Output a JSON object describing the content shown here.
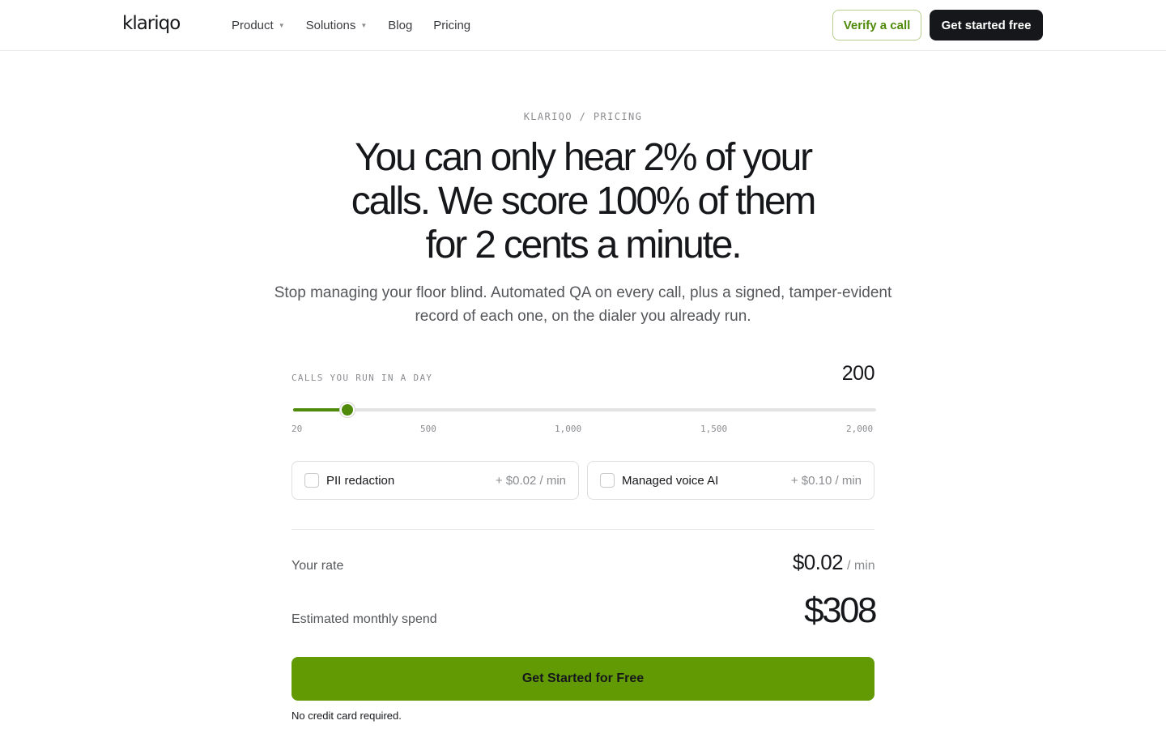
{
  "header": {
    "logo": "klariqo",
    "nav": [
      {
        "label": "Product",
        "has_caret": true
      },
      {
        "label": "Solutions",
        "has_caret": true
      },
      {
        "label": "Blog",
        "has_caret": false
      },
      {
        "label": "Pricing",
        "has_caret": false
      }
    ],
    "verify_label": "Verify a call",
    "start_label": "Get started free"
  },
  "hero": {
    "eyebrow": "KLARIQO / PRICING",
    "headline": "You can only hear 2% of your calls. We score 100% of them for 2 cents a minute.",
    "subhead": "Stop managing your floor blind. Automated QA on every call, plus a signed, tamper-evident record of each one, on the dialer you already run."
  },
  "calculator": {
    "label": "CALLS YOU RUN IN A DAY",
    "value": "200",
    "slider": {
      "min": 20,
      "max": 2000,
      "value": 200
    },
    "ticks": [
      "20",
      "500",
      "1,000",
      "1,500",
      "2,000"
    ],
    "options": [
      {
        "label": "PII redaction",
        "price": "+ $0.02 / min",
        "checked": false
      },
      {
        "label": "Managed voice AI",
        "price": "+ $0.10 / min",
        "checked": false
      }
    ],
    "rate_label": "Your rate",
    "rate_value": "$0.02",
    "rate_unit": "/ min",
    "spend_label": "Estimated monthly spend",
    "spend_value": "$308",
    "cta_label": "Get Started for Free",
    "fineprint": "No credit card required."
  },
  "colors": {
    "accent": "#629a03",
    "accent_dark": "#4f8a0b",
    "dark": "#16171a",
    "muted": "#8a8c90"
  }
}
